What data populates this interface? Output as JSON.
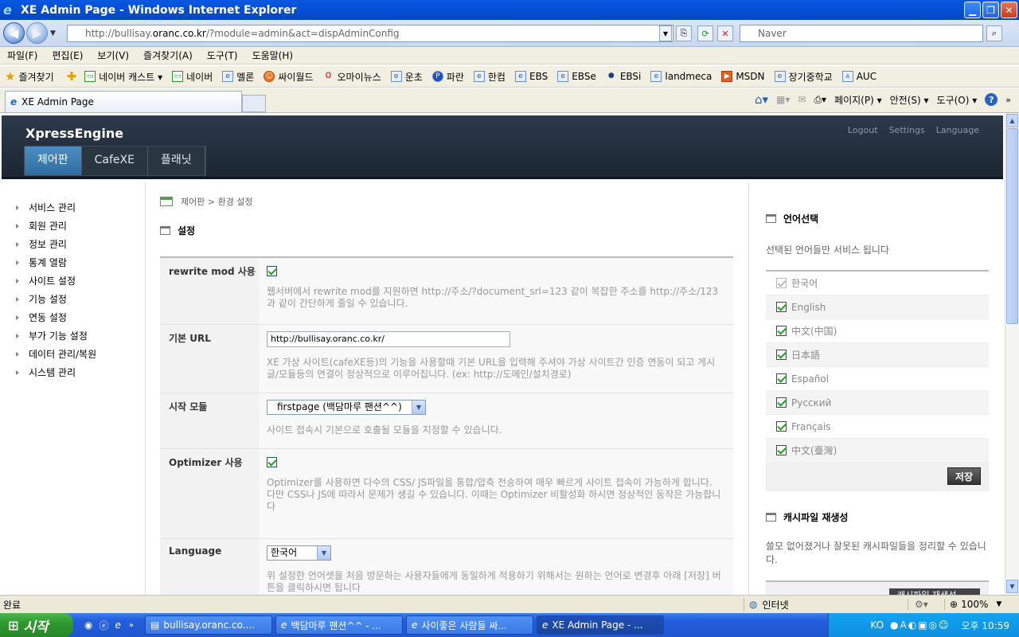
{
  "window": {
    "title": "XE Admin Page - Windows Internet Explorer"
  },
  "address": {
    "prefix": "http://bullisay.",
    "host": "oranc.co.kr",
    "path": "/?module=admin&act=dispAdminConfig",
    "search_placeholder": "Naver"
  },
  "menu": [
    "파일(F)",
    "편집(E)",
    "보기(V)",
    "즐겨찾기(A)",
    "도구(T)",
    "도움말(H)"
  ],
  "favorites": {
    "label": "즐겨찾기",
    "items": [
      "네이버 캐스트 ▾",
      "네이버",
      "멜론",
      "싸이월드",
      "오마이뉴스",
      "운초",
      "파란",
      "한컴",
      "EBS",
      "EBSe",
      "EBSi",
      "landmeca",
      "MSDN",
      "장기중학교",
      "AUC"
    ]
  },
  "tab": {
    "title": "XE Admin Page"
  },
  "commandbar": [
    "페이지(P) ▾",
    "안전(S) ▾",
    "도구(O) ▾"
  ],
  "xe": {
    "logo": "XpressEngine",
    "gnb": [
      "제어판",
      "CafeXE",
      "플래닛"
    ],
    "top_links": [
      "Logout",
      "Settings",
      "Language"
    ],
    "lnb": [
      "서비스 관리",
      "회원 관리",
      "정보 관리",
      "통계 열람",
      "사이트 설정",
      "기능 설정",
      "연동 설정",
      "부가 기능 설정",
      "데이터 관리/복원",
      "시스템 관리"
    ],
    "breadcrumb": "제어판 > 환경 설정",
    "section_title": "설정",
    "form": {
      "rewrite_label": "rewrite mod 사용",
      "rewrite_desc": "웹서버에서 rewrite mod를 지원하면 http://주소/?document_srl=123 같이 복잡한 주소를 http://주소/123과 같이 간단하게 줄일 수 있습니다.",
      "url_label": "기본 URL",
      "url_value": "http://bullisay.oranc.co.kr/",
      "url_desc": "XE 가상 사이트(cafeXE등)의 기능을 사용할때 기본 URL을 입력해 주셔야 가상 사이트간 인증 연동이 되고 게시글/모듈등의 연결이 정상적으로 이루어집니다. (ex: http://도메인/설치경로)",
      "start_label": "시작 모듈",
      "start_value": "firstpage (백담마루 팬션^^)",
      "start_desc": "사이트 접속시 기본으로 호출될 모듈을 지정할 수 있습니다.",
      "opt_label": "Optimizer 사용",
      "opt_desc1": "Optimizer를 사용하면 다수의 CSS/ JS파일을 통합/압축 전송하여 매우 빠르게 사이트 접속이 가능하게 합니다.",
      "opt_desc2": "다만 CSS나 JS에 따라서 문제가 생길 수 있습니다. 이때는 Optimizer 비활성화 하시면 정상적인 동작은 가능합니다",
      "lang_label": "Language",
      "lang_value": "한국어",
      "lang_desc": "위 설정한 언어셋을 처음 방문하는 사용자들에게 동일하게 적용하기 위해서는 원하는 언어로 변경후 아래 [저장] 버튼을 클릭하시면 됩니다"
    },
    "side": {
      "lang_title": "언어선택",
      "lang_desc": "선택된 언어들만 서비스 됩니다",
      "languages": [
        "한국어",
        "English",
        "中文(中国)",
        "日本語",
        "Español",
        "Русский",
        "Français",
        "中文(臺灣)"
      ],
      "save": "저장",
      "cache_title": "캐시파일 재생성",
      "cache_desc": "쓸모 없어졌거나 잘못된 캐시파일들을 정리할 수 있습니다.",
      "cache_btn": "캐시파일 재생성"
    }
  },
  "status": {
    "left": "완료",
    "zone": "인터넷",
    "zoom": "100%"
  },
  "taskbar": {
    "start": "시작",
    "tasks": [
      "bullisay.oranc.co....",
      "백담마루 팬션^^ - ...",
      "사이좋은 사람들 싸...",
      "XE Admin Page - ..."
    ],
    "tray_lang": "KO",
    "time": "오후 10:59"
  }
}
